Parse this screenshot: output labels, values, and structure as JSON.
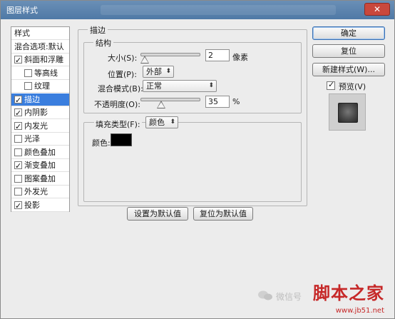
{
  "window": {
    "title": "图层样式",
    "close_label": "✕"
  },
  "left_panel": {
    "items": [
      {
        "label": "样式",
        "checkbox": false,
        "checked": false,
        "indent": false,
        "selected": false
      },
      {
        "label": "混合选项:默认",
        "checkbox": false,
        "checked": false,
        "indent": false,
        "selected": false
      },
      {
        "label": "斜面和浮雕",
        "checkbox": true,
        "checked": true,
        "indent": false,
        "selected": false
      },
      {
        "label": "等高线",
        "checkbox": true,
        "checked": false,
        "indent": true,
        "selected": false
      },
      {
        "label": "纹理",
        "checkbox": true,
        "checked": false,
        "indent": true,
        "selected": false
      },
      {
        "label": "描边",
        "checkbox": true,
        "checked": true,
        "indent": false,
        "selected": true
      },
      {
        "label": "内阴影",
        "checkbox": true,
        "checked": true,
        "indent": false,
        "selected": false
      },
      {
        "label": "内发光",
        "checkbox": true,
        "checked": true,
        "indent": false,
        "selected": false
      },
      {
        "label": "光泽",
        "checkbox": true,
        "checked": false,
        "indent": false,
        "selected": false
      },
      {
        "label": "颜色叠加",
        "checkbox": true,
        "checked": false,
        "indent": false,
        "selected": false
      },
      {
        "label": "渐变叠加",
        "checkbox": true,
        "checked": true,
        "indent": false,
        "selected": false
      },
      {
        "label": "图案叠加",
        "checkbox": true,
        "checked": false,
        "indent": false,
        "selected": false
      },
      {
        "label": "外发光",
        "checkbox": true,
        "checked": false,
        "indent": false,
        "selected": false
      },
      {
        "label": "投影",
        "checkbox": true,
        "checked": true,
        "indent": false,
        "selected": false
      }
    ]
  },
  "stroke": {
    "section_title": "描边",
    "structure_title": "结构",
    "size_label": "大小(S):",
    "size_value": "2",
    "size_unit": "像素",
    "size_level": 0.02,
    "position_label": "位置(P):",
    "position_value": "外部",
    "blend_label": "混合模式(B):",
    "blend_value": "正常",
    "opacity_label": "不透明度(O):",
    "opacity_value": "35",
    "opacity_unit": "%",
    "opacity_level": 0.35,
    "fill_type_label": "填充类型(F):",
    "fill_type_value": "颜色",
    "color_label": "颜色:",
    "color_hex": "#000000"
  },
  "buttons": {
    "set_default": "设置为默认值",
    "reset_default": "复位为默认值",
    "ok": "确定",
    "reset": "复位",
    "new_style": "新建样式(W)...",
    "preview_label": "预览(V)"
  },
  "watermark": {
    "wechat_text": "微信号",
    "brand": "脚本之家",
    "url": "www.jb51.net"
  },
  "colors": {
    "selection": "#3a7ede",
    "titlebar": "#4f79a6",
    "brand_red": "#c62828"
  }
}
